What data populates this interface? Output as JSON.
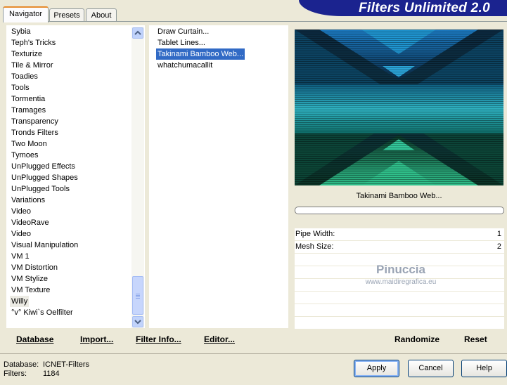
{
  "app": {
    "title": "Filters Unlimited 2.0",
    "colors": {
      "banner": "#1b238f",
      "selection": "#316ac5",
      "panel": "#ece9d8",
      "progress": "#3fbf4f"
    }
  },
  "tabs": [
    {
      "label": "Navigator",
      "active": true
    },
    {
      "label": "Presets",
      "active": false
    },
    {
      "label": "About",
      "active": false
    }
  ],
  "categories": {
    "selected": "Willy",
    "items": [
      "Sybia",
      "Teph's Tricks",
      "Texturize",
      "Tile & Mirror",
      "Toadies",
      "Tools",
      "Tormentia",
      "Tramages",
      "Transparency",
      "Tronds Filters",
      "Two Moon",
      "Tymoes",
      "UnPlugged Effects",
      "UnPlugged Shapes",
      "UnPlugged Tools",
      "Variations",
      "Video",
      "VideoRave",
      "Video",
      "Visual Manipulation",
      "VM 1",
      "VM Distortion",
      "VM Stylize",
      "VM Texture",
      "Willy",
      "°v° Kiwi`s Oelfilter"
    ]
  },
  "filters": {
    "selected": "Takinami Bamboo Web...",
    "items": [
      "Draw Curtain...",
      "Tablet Lines...",
      "Takinami Bamboo Web...",
      "whatchumacallit"
    ]
  },
  "preview": {
    "filter_name": "Takinami Bamboo Web...",
    "progress": 0
  },
  "params": [
    {
      "name": "Pipe Width:",
      "value": "1"
    },
    {
      "name": "Mesh Size:",
      "value": "2"
    },
    {
      "name": "",
      "value": ""
    },
    {
      "name": "",
      "value": ""
    },
    {
      "name": "",
      "value": ""
    },
    {
      "name": "",
      "value": ""
    },
    {
      "name": "",
      "value": ""
    },
    {
      "name": "",
      "value": ""
    }
  ],
  "watermark": {
    "line1": "Pinuccia",
    "line2": "www.maidiregrafica.eu"
  },
  "links": {
    "database": "Database",
    "import": "Import...",
    "filter_info": "Filter Info...",
    "editor": "Editor...",
    "randomize": "Randomize",
    "reset": "Reset"
  },
  "status": {
    "database_label": "Database:",
    "database_value": "ICNET-Filters",
    "filters_label": "Filters:",
    "filters_value": "1184"
  },
  "buttons": {
    "apply": "Apply",
    "cancel": "Cancel",
    "help": "Help"
  },
  "icons": {
    "scroll_up": "chevron-up-icon",
    "scroll_down": "chevron-down-icon"
  }
}
